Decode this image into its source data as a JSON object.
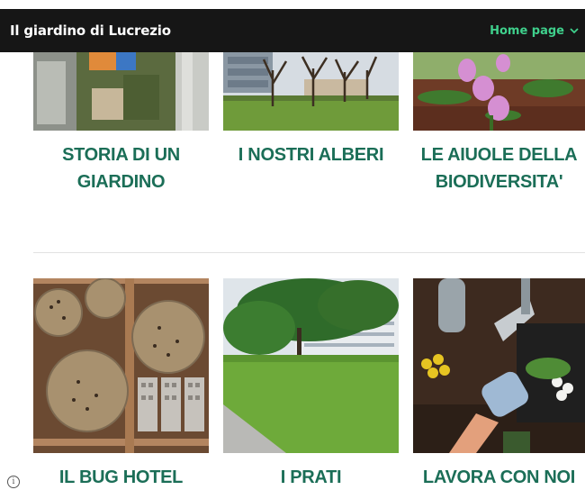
{
  "header": {
    "site_title": "Il giardino di Lucrezio",
    "menu_label": "Home page"
  },
  "cards": [
    {
      "name": "card-storia",
      "label": "STORIA DI UN GIARDINO",
      "lines": [
        "STORIA DI UN",
        "GIARDINO"
      ]
    },
    {
      "name": "card-alberi",
      "label": "I NOSTRI ALBERI",
      "lines": [
        "I NOSTRI ALBERI"
      ]
    },
    {
      "name": "card-aiuole",
      "label": "LE AIUOLE DELLA BIODIVERSITA'",
      "lines": [
        "LE AIUOLE DELLA",
        "BIODIVERSITA'"
      ]
    },
    {
      "name": "card-bug-hotel",
      "label": "IL BUG HOTEL",
      "lines": [
        "IL BUG HOTEL"
      ]
    },
    {
      "name": "card-prati",
      "label": "I PRATI",
      "lines": [
        "I PRATI"
      ]
    },
    {
      "name": "card-lavora",
      "label": "LAVORA CON NOI",
      "lines": [
        "LAVORA CON NOI"
      ]
    }
  ],
  "colors": {
    "header_bg": "#161616",
    "menu_accent": "#3fd08c",
    "caption_green": "#1b6e57"
  },
  "icons": {
    "menu_chevron": "chevron-down-icon",
    "footer_info": "info-icon"
  }
}
